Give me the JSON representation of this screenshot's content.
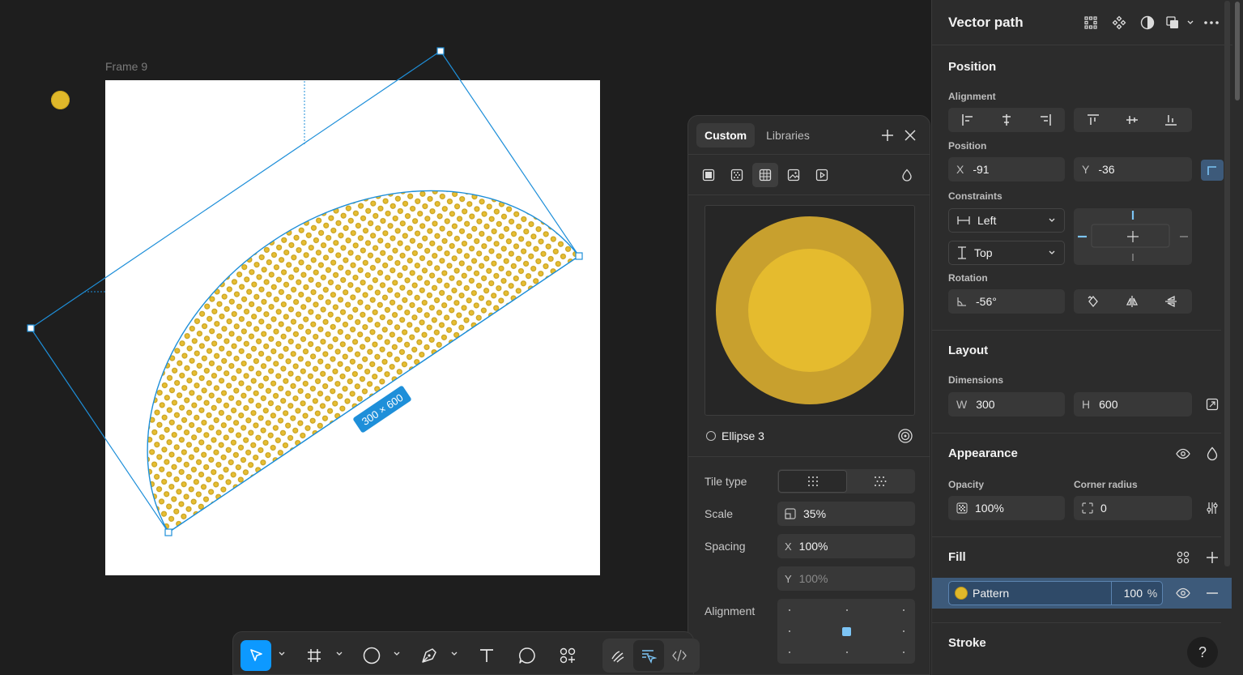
{
  "canvas": {
    "frame_label": "Frame 9",
    "dimension_badge": "300 × 600",
    "fill_color": "#e0b82a",
    "selection_color": "#1e8fd9"
  },
  "picker": {
    "tabs": [
      "Custom",
      "Libraries"
    ],
    "fill_types": [
      "solid-fill-icon",
      "gradient-fill-icon",
      "pattern-fill-icon",
      "image-fill-icon",
      "video-fill-icon"
    ],
    "source_name": "Ellipse 3",
    "tile_type_label": "Tile type",
    "scale_label": "Scale",
    "scale_value": "35%",
    "spacing_label": "Spacing",
    "spacing_x_prefix": "X",
    "spacing_x": "100%",
    "spacing_y_prefix": "Y",
    "spacing_y": "100%",
    "alignment_label": "Alignment"
  },
  "panel": {
    "title": "Vector path",
    "position_section": "Position",
    "alignment_label": "Alignment",
    "position_label": "Position",
    "x_prefix": "X",
    "x_value": "-91",
    "y_prefix": "Y",
    "y_value": "-36",
    "constraints_label": "Constraints",
    "constraint_h": "Left",
    "constraint_v": "Top",
    "rotation_label": "Rotation",
    "rotation_value": "-56°",
    "layout_section": "Layout",
    "dimensions_label": "Dimensions",
    "w_prefix": "W",
    "w_value": "300",
    "h_prefix": "H",
    "h_value": "600",
    "appearance_section": "Appearance",
    "opacity_label": "Opacity",
    "opacity_value": "100%",
    "corner_label": "Corner radius",
    "corner_value": "0",
    "fill_section": "Fill",
    "fill_name": "Pattern",
    "fill_opacity": "100",
    "fill_unit": "%",
    "stroke_section": "Stroke"
  },
  "help_label": "?"
}
